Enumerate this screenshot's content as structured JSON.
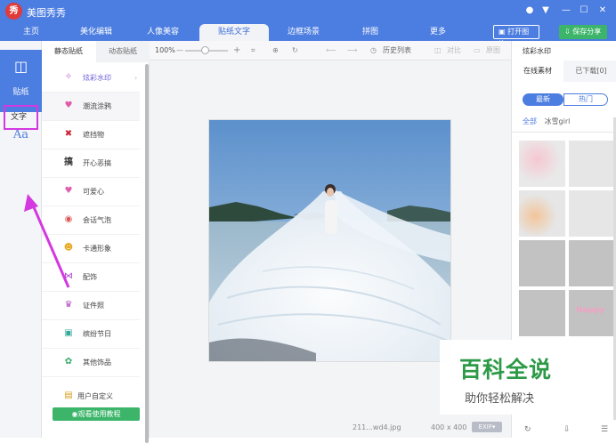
{
  "app": {
    "logo_char": "秀",
    "title": "美图秀秀"
  },
  "window_controls": {
    "chat": "●",
    "menu": "▼",
    "minimize": "—",
    "maximize": "☐",
    "close": "✕"
  },
  "nav": {
    "tabs": [
      "主页",
      "美化编辑",
      "人像美容",
      "贴纸文字",
      "边框场景",
      "拼图",
      "更多"
    ],
    "active": "贴纸文字",
    "open_image": "打开图片",
    "save_share": "保存分享"
  },
  "left_rail": {
    "sticker_icon": "◫",
    "sticker_label": "贴纸",
    "text_icon": "Aa",
    "text_label": "文字"
  },
  "categories": {
    "tabs": [
      "静态贴纸",
      "动态贴纸"
    ],
    "items": [
      {
        "label": "炫彩水印",
        "icon": "✧"
      },
      {
        "label": "潮流涂鸦",
        "icon": "♥"
      },
      {
        "label": "遮挡物",
        "icon": "✖"
      },
      {
        "label": "开心恶搞",
        "icon": "搞"
      },
      {
        "label": "可爱心",
        "icon": "♥"
      },
      {
        "label": "会话气泡",
        "icon": "◉"
      },
      {
        "label": "卡通形象",
        "icon": "☻"
      },
      {
        "label": "配饰",
        "icon": "⋈"
      },
      {
        "label": "证件照",
        "icon": "♛"
      },
      {
        "label": "缤纷节日",
        "icon": "▣"
      },
      {
        "label": "其他饰品",
        "icon": "✿"
      },
      {
        "label": "用户自定义",
        "icon": "▤"
      }
    ],
    "tutorial": "◉观看使用教程"
  },
  "toolbar": {
    "zoom": "100%",
    "minus": "—",
    "plus": "+",
    "history": "历史列表",
    "compare": "对比",
    "original": "原图"
  },
  "status": {
    "filename": "211...wd4.jpg",
    "dimensions": "400 x 400",
    "exif": "EXIF▾"
  },
  "right_panel": {
    "title": "炫彩水印",
    "tabs": [
      "在线素材",
      "已下载[0]"
    ],
    "seg": [
      "最新",
      "热门"
    ],
    "filters": [
      "全部",
      "冰雪girl"
    ],
    "thumb_text": "Happy"
  },
  "watermark": {
    "main": "百科全说",
    "sub": "助你轻松解决"
  }
}
